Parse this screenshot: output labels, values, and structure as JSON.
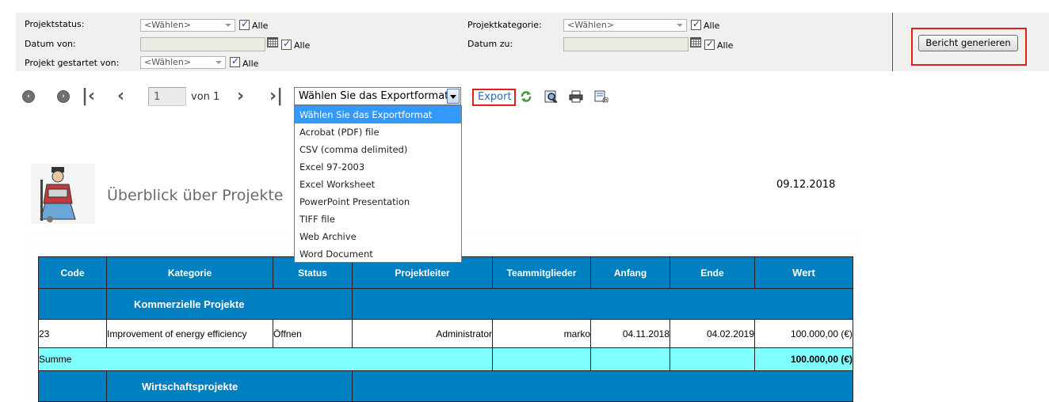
{
  "params": {
    "project_status_label": "Projektstatus:",
    "project_status_value": "<Wählen>",
    "date_from_label": "Datum von:",
    "project_started_label": "Projekt gestartet von:",
    "project_started_value": "<Wählen>",
    "project_category_label": "Projektkategorie:",
    "project_category_value": "<Wählen>",
    "date_to_label": "Datum zu:",
    "all_label": "Alle"
  },
  "actions": {
    "generate_label": "Bericht generieren"
  },
  "toolbar": {
    "page_value": "1",
    "of_label": "von 1",
    "export_select_value": "Wählen Sie das Exportformat",
    "export_label": "Export",
    "export_options": [
      "Wählen Sie das Exportformat",
      "Acrobat (PDF) file",
      "CSV (comma delimited)",
      "Excel 97-2003",
      "Excel Worksheet",
      "PowerPoint Presentation",
      "TIFF file",
      "Web Archive",
      "Word Document"
    ]
  },
  "report": {
    "title": "Überblick über Projekte",
    "date": "09.12.2018",
    "columns": [
      "Code",
      "Kategorie",
      "Status",
      "Projektleiter",
      "Teammitglieder",
      "Anfang",
      "Ende",
      "Wert"
    ],
    "groups": [
      {
        "name": "Kommerzielle Projekte",
        "rows": [
          {
            "code": "23",
            "category": "Improvement of energy efficiency",
            "status": "Öffnen",
            "lead": "Administrator",
            "team": "marko",
            "start": "04.11.2018",
            "end": "04.02.2019",
            "value": "100.000,00 (€)"
          }
        ],
        "sum_label": "Summe",
        "sum_value": "100.000,00 (€)"
      },
      {
        "name": "Wirtschaftsprojekte"
      }
    ]
  }
}
